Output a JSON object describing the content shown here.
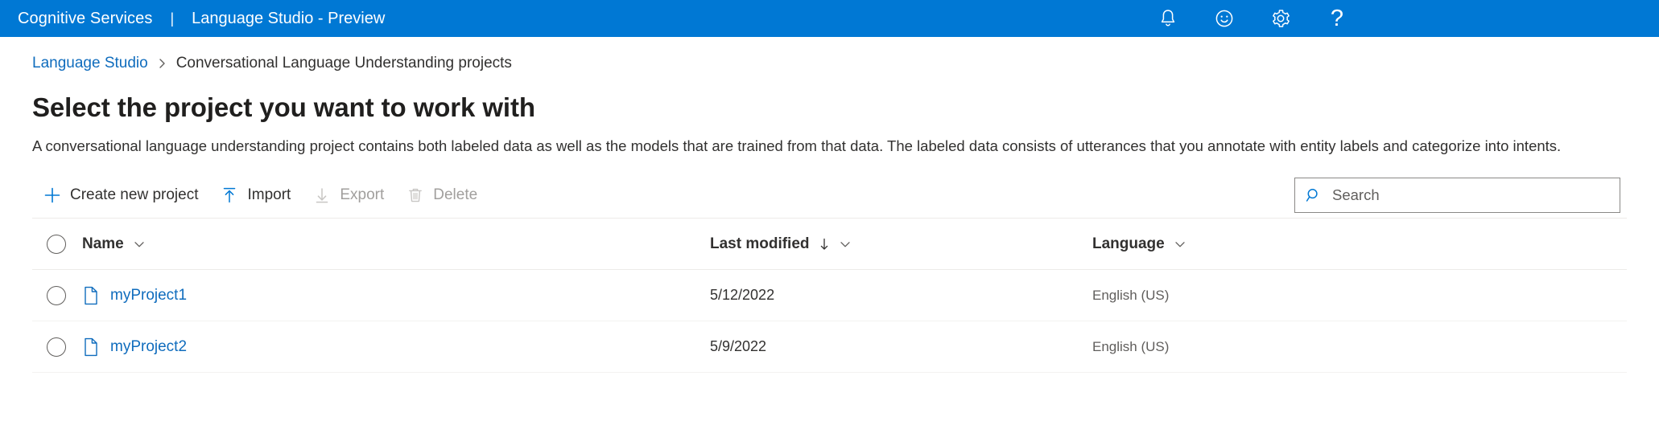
{
  "topbar": {
    "brand": "Cognitive Services",
    "separator": "|",
    "app_name": "Language Studio - Preview",
    "accent_color": "#0078d4",
    "icons": [
      {
        "name": "notifications-bell-icon",
        "label": "Notifications"
      },
      {
        "name": "feedback-smiley-icon",
        "label": "Feedback"
      },
      {
        "name": "settings-gear-icon",
        "label": "Settings"
      },
      {
        "name": "help-question-icon",
        "label": "?"
      }
    ]
  },
  "breadcrumb": {
    "root": "Language Studio",
    "separator": "›",
    "current": "Conversational Language Understanding projects"
  },
  "page": {
    "title": "Select the project you want to work with",
    "description": "A conversational language understanding project contains both labeled data as well as the models that are trained from that data. The labeled data consists of utterances that you annotate with entity labels and categorize into intents."
  },
  "toolbar": {
    "commands": [
      {
        "id": "create-new-project",
        "label": "Create new project",
        "icon": "plus-icon",
        "disabled": false
      },
      {
        "id": "import",
        "label": "Import",
        "icon": "upload-arrow-icon",
        "disabled": false
      },
      {
        "id": "export",
        "label": "Export",
        "icon": "download-arrow-icon",
        "disabled": true
      },
      {
        "id": "delete",
        "label": "Delete",
        "icon": "trash-icon",
        "disabled": true
      }
    ],
    "search": {
      "placeholder": "Search",
      "value": "",
      "icon": "search-icon"
    }
  },
  "table": {
    "columns": [
      {
        "id": "name",
        "label": "Name",
        "sorted": false,
        "chevron": true
      },
      {
        "id": "last-modified",
        "label": "Last modified",
        "sorted": true,
        "sort_direction": "↓",
        "chevron": true
      },
      {
        "id": "language",
        "label": "Language",
        "sorted": false,
        "chevron": true
      }
    ],
    "rows": [
      {
        "name": "myProject1",
        "last_modified": "5/12/2022",
        "language": "English (US)",
        "selected": false
      },
      {
        "name": "myProject2",
        "last_modified": "5/9/2022",
        "language": "English (US)",
        "selected": false
      }
    ]
  },
  "colors": {
    "header_blue": "#0078d4",
    "link_blue": "#0f6cbd",
    "icon_blue": "#0078d4",
    "text_primary": "#323130",
    "text_disabled": "#a19f9d",
    "divider": "#edebe9"
  }
}
